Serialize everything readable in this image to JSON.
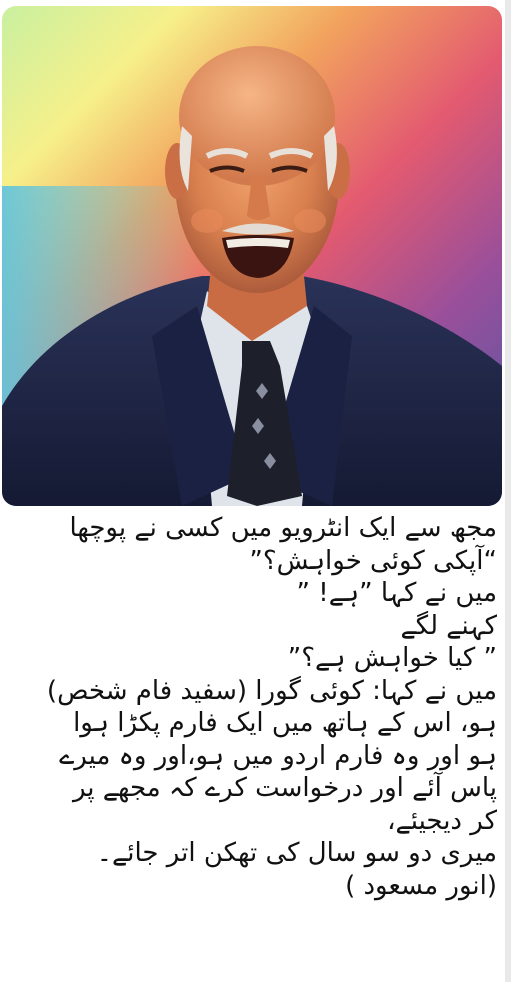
{
  "post": {
    "photo_alt": "Smiling elderly man in a dark suit and patterned tie against a rainbow background",
    "lines": [
      "مجھ سے ایک انٹرویو میں کسی نے پوچھا",
      "“آپکی کوئی خواہش؟”",
      "میں نے کہا ”ہے! ”",
      "کہنے لگے",
      "” کیا خواہش ہے؟”",
      "میں نے کہا: کوئی گورا (سفید فام شخص)",
      "ہو، اس کے ہاتھ میں ایک فارم پکڑا ہوا",
      "ہو اور وہ فارم اردو میں ہو،اور وہ میرے",
      "پاس آئے اور درخواست کرے کہ مجھے پر",
      "کر دیجیئے،",
      "میری دو سو سال کی تھکن اتر جائے۔",
      "(انور مسعود )"
    ]
  }
}
